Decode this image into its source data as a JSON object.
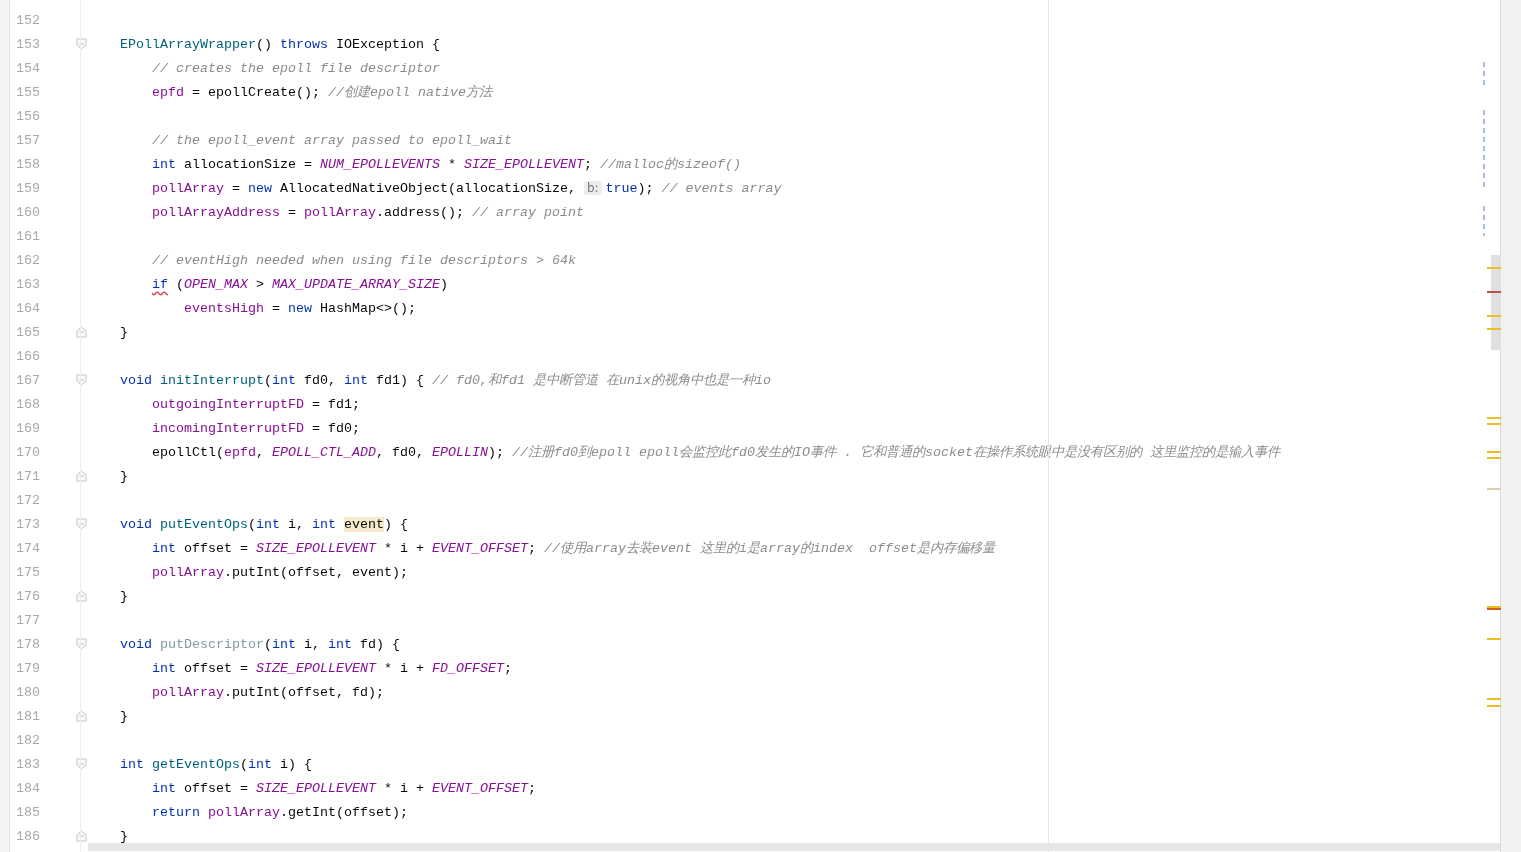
{
  "editor": {
    "lines": [
      {
        "number": "152",
        "fold_start": false,
        "fold_end": false
      },
      {
        "number": "153",
        "fold_start": true,
        "fold_end": false,
        "tokens": [
          {
            "text": "EPollArrayWrapper",
            "kind": "method"
          },
          {
            "text": "() ",
            "kind": "plain"
          },
          {
            "text": "throws",
            "kind": "keyword"
          },
          {
            "text": " IOException {",
            "kind": "plain"
          }
        ],
        "children": [
          {
            "number": "154",
            "fold_start": false,
            "fold_end": false,
            "tokens": [
              {
                "text": "// creates the epoll file descriptor",
                "kind": "comment"
              }
            ]
          },
          {
            "number": "155",
            "fold_start": false,
            "fold_end": false,
            "tokens": [
              {
                "text": "epfd",
                "kind": "field"
              },
              {
                "text": " = epollCreate(); ",
                "kind": "plain"
              },
              {
                "text": "//创建epoll native方法",
                "kind": "comment"
              }
            ]
          },
          {
            "number": "156",
            "fold_start": false,
            "fold_end": false
          },
          {
            "number": "157",
            "fold_start": false,
            "fold_end": false,
            "tokens": [
              {
                "text": "// the epoll_event array passed to epoll_wait",
                "kind": "comment"
              }
            ]
          },
          {
            "number": "158",
            "fold_start": false,
            "fold_end": false,
            "tokens": [
              {
                "text": "int",
                "kind": "keyword"
              },
              {
                "text": " allocationSize = ",
                "kind": "plain"
              },
              {
                "text": "NUM_EPOLLEVENTS",
                "kind": "constant"
              },
              {
                "text": " * ",
                "kind": "plain"
              },
              {
                "text": "SIZE_EPOLLEVENT",
                "kind": "constant"
              },
              {
                "text": "; ",
                "kind": "plain"
              },
              {
                "text": "//malloc的sizeof()",
                "kind": "comment"
              }
            ]
          },
          {
            "number": "159",
            "fold_start": false,
            "fold_end": false,
            "tokens": [
              {
                "text": "pollArray",
                "kind": "field"
              },
              {
                "text": " = ",
                "kind": "plain"
              },
              {
                "text": "new",
                "kind": "keyword"
              },
              {
                "text": " AllocatedNativeObject(allocationSize, ",
                "kind": "plain"
              },
              {
                "text": "b:",
                "kind": "hint"
              },
              {
                "text": "true",
                "kind": "keyword"
              },
              {
                "text": "); ",
                "kind": "plain"
              },
              {
                "text": "// events array",
                "kind": "comment"
              }
            ]
          },
          {
            "number": "160",
            "fold_start": false,
            "fold_end": false,
            "tokens": [
              {
                "text": "pollArrayAddress",
                "kind": "field"
              },
              {
                "text": " = ",
                "kind": "plain"
              },
              {
                "text": "pollArray",
                "kind": "field"
              },
              {
                "text": ".address(); ",
                "kind": "plain"
              },
              {
                "text": "// array point",
                "kind": "comment"
              }
            ]
          },
          {
            "number": "161",
            "fold_start": false,
            "fold_end": false
          },
          {
            "number": "162",
            "fold_start": false,
            "fold_end": false,
            "tokens": [
              {
                "text": "// eventHigh needed when using file descriptors > 64k",
                "kind": "comment"
              }
            ]
          },
          {
            "number": "163",
            "fold_start": false,
            "fold_end": false,
            "tokens": [
              {
                "text": "if",
                "kind": "warning"
              },
              {
                "text": " (",
                "kind": "plain"
              },
              {
                "text": "OPEN_MAX",
                "kind": "constant"
              },
              {
                "text": " > ",
                "kind": "plain"
              },
              {
                "text": "MAX_UPDATE_ARRAY_SIZE",
                "kind": "constant"
              },
              {
                "text": ")",
                "kind": "plain"
              }
            ],
            "children": [
              {
                "number": "164",
                "fold_start": false,
                "fold_end": false,
                "tokens": [
                  {
                    "text": "eventsHigh",
                    "kind": "field"
                  },
                  {
                    "text": " = ",
                    "kind": "plain"
                  },
                  {
                    "text": "new",
                    "kind": "keyword"
                  },
                  {
                    "text": " HashMap<>();",
                    "kind": "plain"
                  }
                ]
              }
            ]
          }
        ]
      },
      {
        "number": "165",
        "fold_start": false,
        "fold_end": true,
        "tokens": [
          {
            "text": "}",
            "kind": "plain"
          }
        ]
      },
      {
        "number": "166",
        "fold_start": false,
        "fold_end": false
      },
      {
        "number": "167",
        "fold_start": true,
        "fold_end": false,
        "tokens": [
          {
            "text": "void ",
            "kind": "keyword"
          },
          {
            "text": "initInterrupt",
            "kind": "method"
          },
          {
            "text": "(",
            "kind": "plain"
          },
          {
            "text": "int",
            "kind": "keyword"
          },
          {
            "text": " fd0, ",
            "kind": "plain"
          },
          {
            "text": "int",
            "kind": "keyword"
          },
          {
            "text": " fd1) { ",
            "kind": "plain"
          },
          {
            "text": "// fd0,和fd1 是中断管道 在unix的视角中也是一种io",
            "kind": "comment"
          }
        ],
        "children": [
          {
            "number": "168",
            "fold_start": false,
            "fold_end": false,
            "tokens": [
              {
                "text": "outgoingInterruptFD",
                "kind": "field"
              },
              {
                "text": " = fd1;",
                "kind": "plain"
              }
            ]
          },
          {
            "number": "169",
            "fold_start": false,
            "fold_end": false,
            "tokens": [
              {
                "text": "incomingInterruptFD",
                "kind": "field"
              },
              {
                "text": " = fd0;",
                "kind": "plain"
              }
            ]
          },
          {
            "number": "170",
            "fold_start": false,
            "fold_end": false,
            "tokens": [
              {
                "text": "epollCtl(",
                "kind": "plain"
              },
              {
                "text": "epfd",
                "kind": "field"
              },
              {
                "text": ", ",
                "kind": "plain"
              },
              {
                "text": "EPOLL_CTL_ADD",
                "kind": "constant"
              },
              {
                "text": ", fd0, ",
                "kind": "plain"
              },
              {
                "text": "EPOLLIN",
                "kind": "constant"
              },
              {
                "text": "); ",
                "kind": "plain"
              },
              {
                "text": "//注册fd0到epoll epoll会监控此fd0发生的IO事件 . 它和普通的socket在操作系统眼中是没有区别的 这里监控的是输入事件",
                "kind": "comment"
              }
            ]
          }
        ]
      },
      {
        "number": "171",
        "fold_start": false,
        "fold_end": true,
        "tokens": [
          {
            "text": "}",
            "kind": "plain"
          }
        ]
      },
      {
        "number": "172",
        "fold_start": false,
        "fold_end": false
      },
      {
        "number": "173",
        "fold_start": true,
        "fold_end": false,
        "tokens": [
          {
            "text": "void ",
            "kind": "keyword"
          },
          {
            "text": "putEventOps",
            "kind": "method"
          },
          {
            "text": "(",
            "kind": "plain"
          },
          {
            "text": "int",
            "kind": "keyword"
          },
          {
            "text": " i, ",
            "kind": "plain"
          },
          {
            "text": "int ",
            "kind": "keyword"
          },
          {
            "text": "event",
            "kind": "highlight"
          },
          {
            "text": ") {",
            "kind": "plain"
          }
        ],
        "children": [
          {
            "number": "174",
            "fold_start": false,
            "fold_end": false,
            "tokens": [
              {
                "text": "int",
                "kind": "keyword"
              },
              {
                "text": " offset = ",
                "kind": "plain"
              },
              {
                "text": "SIZE_EPOLLEVENT",
                "kind": "constant"
              },
              {
                "text": " * i + ",
                "kind": "plain"
              },
              {
                "text": "EVENT_OFFSET",
                "kind": "constant"
              },
              {
                "text": "; ",
                "kind": "plain"
              },
              {
                "text": "//使用array去装event 这里的i是array的index  offset是内存偏移量",
                "kind": "comment"
              }
            ]
          },
          {
            "number": "175",
            "fold_start": false,
            "fold_end": false,
            "tokens": [
              {
                "text": "pollArray",
                "kind": "field"
              },
              {
                "text": ".putInt(offset, event);",
                "kind": "plain"
              }
            ]
          }
        ]
      },
      {
        "number": "176",
        "fold_start": false,
        "fold_end": true,
        "tokens": [
          {
            "text": "}",
            "kind": "plain"
          }
        ]
      },
      {
        "number": "177",
        "fold_start": false,
        "fold_end": false
      },
      {
        "number": "178",
        "fold_start": true,
        "fold_end": false,
        "tokens": [
          {
            "text": "void ",
            "kind": "keyword"
          },
          {
            "text": "putDescriptor",
            "kind": "unused"
          },
          {
            "text": "(",
            "kind": "plain"
          },
          {
            "text": "int",
            "kind": "keyword"
          },
          {
            "text": " i, ",
            "kind": "plain"
          },
          {
            "text": "int",
            "kind": "keyword"
          },
          {
            "text": " fd) {",
            "kind": "plain"
          }
        ],
        "children": [
          {
            "number": "179",
            "fold_start": false,
            "fold_end": false,
            "tokens": [
              {
                "text": "int",
                "kind": "keyword"
              },
              {
                "text": " offset = ",
                "kind": "plain"
              },
              {
                "text": "SIZE_EPOLLEVENT",
                "kind": "constant"
              },
              {
                "text": " * i + ",
                "kind": "plain"
              },
              {
                "text": "FD_OFFSET",
                "kind": "constant"
              },
              {
                "text": ";",
                "kind": "plain"
              }
            ]
          },
          {
            "number": "180",
            "fold_start": false,
            "fold_end": false,
            "tokens": [
              {
                "text": "pollArray",
                "kind": "field"
              },
              {
                "text": ".putInt(offset, fd);",
                "kind": "plain"
              }
            ]
          }
        ]
      },
      {
        "number": "181",
        "fold_start": false,
        "fold_end": true,
        "tokens": [
          {
            "text": "}",
            "kind": "plain"
          }
        ]
      },
      {
        "number": "182",
        "fold_start": false,
        "fold_end": false
      },
      {
        "number": "183",
        "fold_start": true,
        "fold_end": false,
        "tokens": [
          {
            "text": "int ",
            "kind": "keyword"
          },
          {
            "text": "getEventOps",
            "kind": "method"
          },
          {
            "text": "(",
            "kind": "plain"
          },
          {
            "text": "int",
            "kind": "keyword"
          },
          {
            "text": " i) {",
            "kind": "plain"
          }
        ],
        "children": [
          {
            "number": "184",
            "fold_start": false,
            "fold_end": false,
            "tokens": [
              {
                "text": "int",
                "kind": "keyword"
              },
              {
                "text": " offset = ",
                "kind": "plain"
              },
              {
                "text": "SIZE_EPOLLEVENT",
                "kind": "constant"
              },
              {
                "text": " * i + ",
                "kind": "plain"
              },
              {
                "text": "EVENT_OFFSET",
                "kind": "constant"
              },
              {
                "text": ";",
                "kind": "plain"
              }
            ]
          },
          {
            "number": "185",
            "fold_start": false,
            "fold_end": false,
            "tokens": [
              {
                "text": "return ",
                "kind": "keyword"
              },
              {
                "text": "pollArray",
                "kind": "field"
              },
              {
                "text": ".getInt(offset);",
                "kind": "plain"
              }
            ]
          }
        ]
      },
      {
        "number": "186",
        "fold_start": false,
        "fold_end": true,
        "tokens": [
          {
            "text": "}",
            "kind": "plain"
          }
        ]
      }
    ]
  }
}
